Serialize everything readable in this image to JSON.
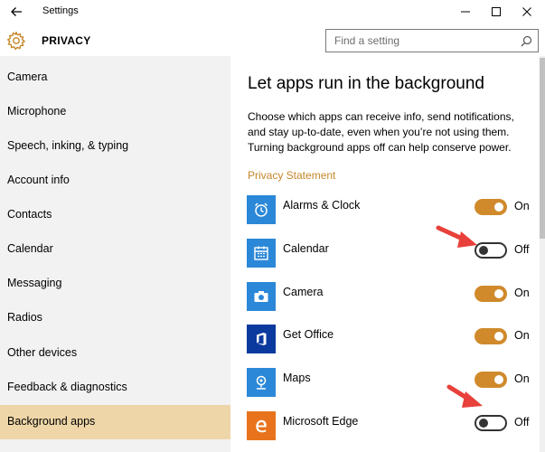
{
  "window": {
    "title": "Settings"
  },
  "header": {
    "title": "PRIVACY",
    "search_placeholder": "Find a setting"
  },
  "sidebar": {
    "items": [
      {
        "label": "Camera",
        "active": false
      },
      {
        "label": "Microphone",
        "active": false
      },
      {
        "label": "Speech, inking, & typing",
        "active": false
      },
      {
        "label": "Account info",
        "active": false
      },
      {
        "label": "Contacts",
        "active": false
      },
      {
        "label": "Calendar",
        "active": false
      },
      {
        "label": "Messaging",
        "active": false
      },
      {
        "label": "Radios",
        "active": false
      },
      {
        "label": "Other devices",
        "active": false
      },
      {
        "label": "Feedback & diagnostics",
        "active": false
      },
      {
        "label": "Background apps",
        "active": true
      }
    ]
  },
  "main": {
    "heading": "Let apps run in the background",
    "description": "Choose which apps can receive info, send notifications, and stay up-to-date, even when you’re not using them. Turning background apps off can help conserve power.",
    "privacy_link": "Privacy Statement",
    "apps": [
      {
        "name": "Alarms & Clock",
        "state": "On",
        "on": true,
        "icon": "alarm-clock-icon",
        "tile_color": "#2b88d8"
      },
      {
        "name": "Calendar",
        "state": "Off",
        "on": false,
        "icon": "calendar-icon",
        "tile_color": "#2b88d8"
      },
      {
        "name": "Camera",
        "state": "On",
        "on": true,
        "icon": "camera-icon",
        "tile_color": "#2b88d8"
      },
      {
        "name": "Get Office",
        "state": "On",
        "on": true,
        "icon": "office-icon",
        "tile_color": "#0a3a9e"
      },
      {
        "name": "Maps",
        "state": "On",
        "on": true,
        "icon": "maps-icon",
        "tile_color": "#2b88d8"
      },
      {
        "name": "Microsoft Edge",
        "state": "Off",
        "on": false,
        "icon": "edge-icon",
        "tile_color": "#e8731c"
      }
    ]
  },
  "colors": {
    "accent": "#d08a2b",
    "sidebar_active": "#efd6a8",
    "sidebar_bg": "#f2f2f2",
    "link": "#c6862a",
    "annotation_arrow": "#e8403a"
  }
}
